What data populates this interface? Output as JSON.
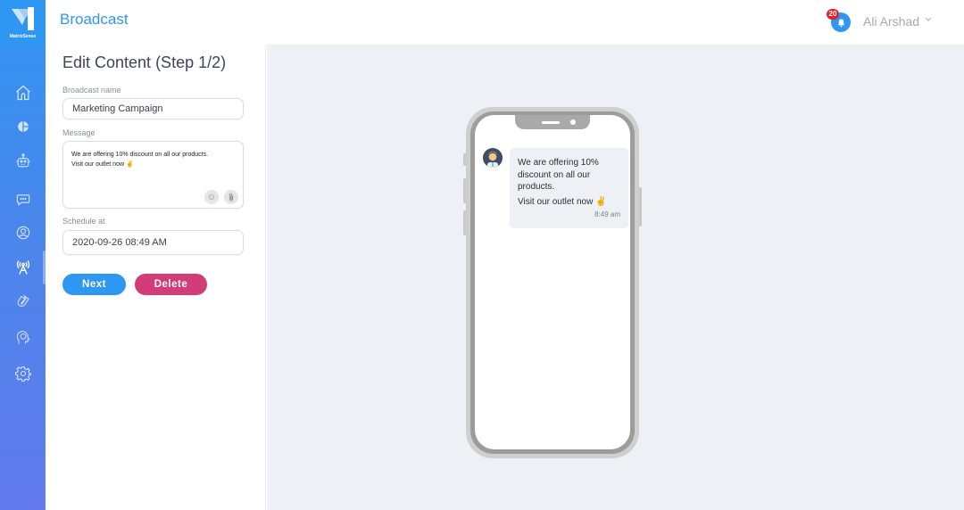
{
  "app": {
    "brand_name": "MatrixSense",
    "brand_color": "#2e96f3"
  },
  "header": {
    "title": "Broadcast",
    "notifications": {
      "icon": "bell-icon",
      "count": "20"
    },
    "user": {
      "name": "Ali Arshad",
      "chevron": "⌄"
    }
  },
  "sidebar": {
    "items": [
      {
        "name": "home",
        "icon": "home-icon",
        "active": false
      },
      {
        "name": "analytics",
        "icon": "pie-chart-icon",
        "active": false
      },
      {
        "name": "bots",
        "icon": "robot-icon",
        "active": false
      },
      {
        "name": "conversations",
        "icon": "chat-icon",
        "active": false
      },
      {
        "name": "contacts",
        "icon": "user-circle-icon",
        "active": false
      },
      {
        "name": "broadcast",
        "icon": "antenna-icon",
        "active": true
      },
      {
        "name": "integrations",
        "icon": "magnet-icon",
        "active": false
      },
      {
        "name": "training",
        "icon": "brain-head-icon",
        "active": false
      },
      {
        "name": "settings",
        "icon": "gear-icon",
        "active": false
      }
    ]
  },
  "form": {
    "title": "Edit Content (Step 1/2)",
    "broadcast_name": {
      "label": "Broadcast name",
      "value": "Marketing Campaign"
    },
    "message": {
      "label": "Message",
      "line1": "We are offering 10% discount on all our products.",
      "line2": "Visit our outlet now ✌️",
      "emoji_button_icon": "☺",
      "attach_button_icon": "📎"
    },
    "schedule": {
      "label": "Schedule at",
      "value": "2020-09-26 08:49 AM"
    },
    "next_label": "Next",
    "delete_label": "Delete"
  },
  "preview": {
    "bubble_line1": "We are offering 10% discount on all our products.",
    "bubble_line2": "Visit our outlet now ✌️",
    "time": "8:49 am"
  },
  "colors": {
    "primary": "#2e97f1",
    "danger": "#d33d77",
    "badge": "#e0242f",
    "preview_bg": "#edf1f5"
  }
}
